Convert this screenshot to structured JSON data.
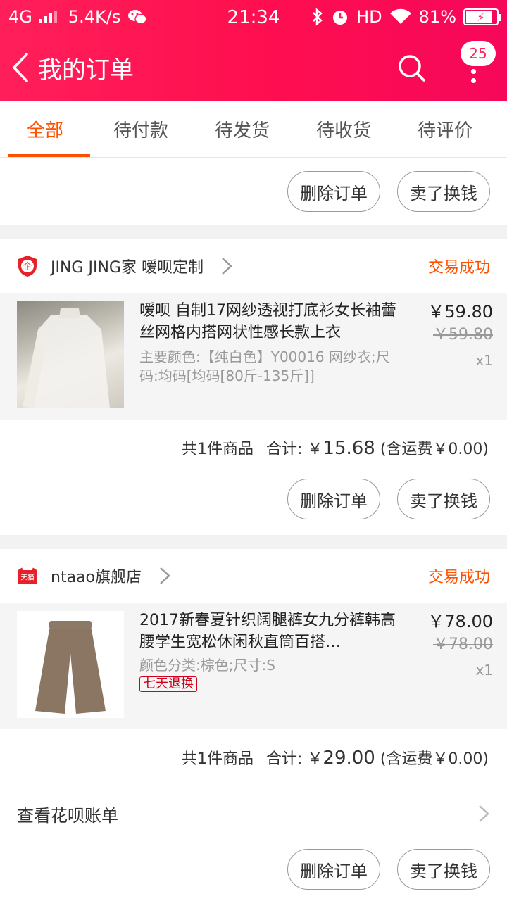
{
  "statusbar": {
    "network": "4G",
    "speed": "5.4K/s",
    "time": "21:34",
    "hd": "HD",
    "battery": "81%"
  },
  "header": {
    "title": "我的订单",
    "badge_count": "25"
  },
  "tabs": [
    {
      "label": "全部",
      "active": true
    },
    {
      "label": "待付款",
      "active": false
    },
    {
      "label": "待发货",
      "active": false
    },
    {
      "label": "待收货",
      "active": false
    },
    {
      "label": "待评价",
      "active": false
    }
  ],
  "actions": {
    "delete": "删除订单",
    "sell": "卖了换钱"
  },
  "orders": [
    {
      "shop_name": "JING JING家 嗳呗定制",
      "shop_logo_text": "企",
      "status": "交易成功",
      "item": {
        "title": "嗳呗 自制17网纱透视打底衫女长袖蕾丝网格内搭网状性感长款上衣",
        "sku": "主要颜色:【纯白色】Y00016 网纱衣;尺码:均码[均码[80斤-135斤]]",
        "price": "￥59.80",
        "price_old": "￥59.80",
        "qty": "x1"
      },
      "summary": {
        "count": "共1件商品",
        "total_label": "合计: ￥",
        "total": "15.68",
        "shipping": "(含运费￥0.00)"
      }
    },
    {
      "shop_name": "ntaao旗舰店",
      "shop_logo_text": "天猫",
      "status": "交易成功",
      "item": {
        "title": "2017新春夏针织阔腿裤女九分裤韩高腰学生宽松休闲秋直筒百搭…",
        "sku": "颜色分类:棕色;尺寸:S",
        "tag": "七天退换",
        "price": "￥78.00",
        "price_old": "￥78.00",
        "qty": "x1"
      },
      "summary": {
        "count": "共1件商品",
        "total_label": "合计: ￥",
        "total": "29.00",
        "shipping": "(含运费￥0.00)"
      },
      "huabei": "查看花呗账单"
    }
  ],
  "colors": {
    "brand": "#ff1f5a",
    "accent": "#ff5000",
    "tag": "#d0021b"
  }
}
